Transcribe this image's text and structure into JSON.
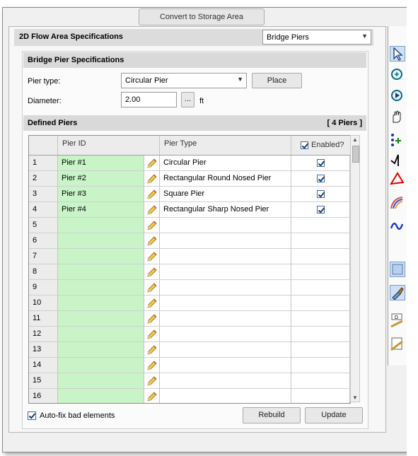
{
  "top_button": {
    "label": "Convert to Storage Area"
  },
  "header": {
    "title": "2D Flow Area Specifications",
    "dropdown_value": "Bridge Piers"
  },
  "pier_specs": {
    "title": "Bridge Pier Specifications",
    "pier_type_label": "Pier type:",
    "pier_type_value": "Circular Pier",
    "place_button": "Place",
    "diameter_label": "Diameter:",
    "diameter_value": "2.00",
    "browse_button": "...",
    "unit": "ft"
  },
  "defined_piers": {
    "title": "Defined Piers",
    "count": "[ 4 Piers ]",
    "columns": {
      "id": "Pier ID",
      "type": "Pier Type",
      "enabled": "Enabled?"
    },
    "header_enabled_checked": true,
    "rows": [
      {
        "num": "1",
        "id": "Pier #1",
        "type": "Circular Pier",
        "enabled": true
      },
      {
        "num": "2",
        "id": "Pier #2",
        "type": "Rectangular Round Nosed Pier",
        "enabled": true
      },
      {
        "num": "3",
        "id": "Pier #3",
        "type": "Square Pier",
        "enabled": true
      },
      {
        "num": "4",
        "id": "Pier #4",
        "type": "Rectangular Sharp Nosed Pier",
        "enabled": true
      },
      {
        "num": "5",
        "id": "",
        "type": "",
        "enabled": false
      },
      {
        "num": "6",
        "id": "",
        "type": "",
        "enabled": false
      },
      {
        "num": "7",
        "id": "",
        "type": "",
        "enabled": false
      },
      {
        "num": "8",
        "id": "",
        "type": "",
        "enabled": false
      },
      {
        "num": "9",
        "id": "",
        "type": "",
        "enabled": false
      },
      {
        "num": "10",
        "id": "",
        "type": "",
        "enabled": false
      },
      {
        "num": "11",
        "id": "",
        "type": "",
        "enabled": false
      },
      {
        "num": "12",
        "id": "",
        "type": "",
        "enabled": false
      },
      {
        "num": "13",
        "id": "",
        "type": "",
        "enabled": false
      },
      {
        "num": "14",
        "id": "",
        "type": "",
        "enabled": false
      },
      {
        "num": "15",
        "id": "",
        "type": "",
        "enabled": false
      },
      {
        "num": "16",
        "id": "",
        "type": "",
        "enabled": false
      }
    ]
  },
  "footer": {
    "autofix_label": "Auto-fix bad elements",
    "autofix_checked": true,
    "rebuild_button": "Rebuild",
    "update_button": "Update"
  },
  "toolbar_icons": [
    "select-arrow-icon",
    "zoom-in-icon",
    "pan-icon",
    "hand-icon",
    "add-point-icon",
    "polyline-icon",
    "polygon-icon",
    "rainbow-line-icon",
    "wave-line-icon",
    "layer-select-icon",
    "paint-icon",
    "ruler-d-icon",
    "ruler-icon"
  ]
}
